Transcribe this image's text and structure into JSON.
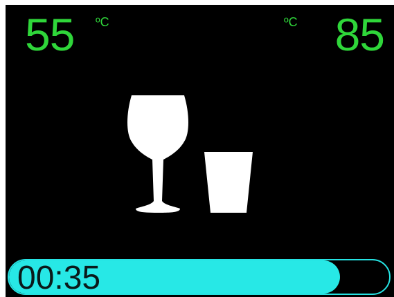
{
  "display": {
    "temp_left": "55",
    "temp_left_unit": "ºC",
    "temp_right": "85",
    "temp_right_unit": "ºC",
    "timer": "00:35",
    "progress_fraction": 0.87,
    "accent_color": "#2fd63a",
    "progress_color": "#27e8e6",
    "icons": [
      "wine-glass-icon",
      "tumbler-glass-icon"
    ]
  }
}
